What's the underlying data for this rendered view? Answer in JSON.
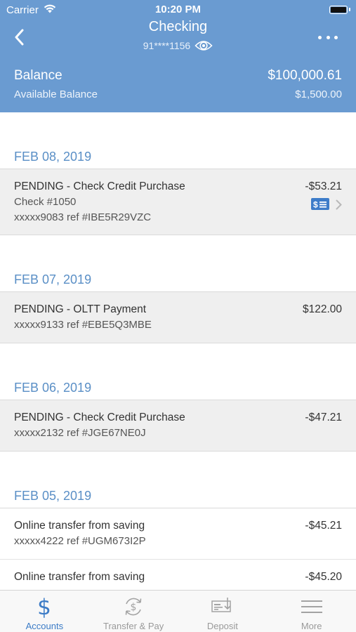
{
  "status_bar": {
    "carrier": "Carrier",
    "time": "10:20 PM"
  },
  "header": {
    "title": "Checking",
    "account_number": "91****1156",
    "balance_label": "Balance",
    "balance_value": "$100,000.61",
    "available_label": "Available Balance",
    "available_value": "$1,500.00"
  },
  "groups": [
    {
      "date": "FEB 08, 2019",
      "transactions": [
        {
          "description": "PENDING - Check Credit Purchase",
          "check": "Check #1050",
          "reference": "xxxxx9083 ref #IBE5R29VZC",
          "amount": "-$53.21"
        }
      ]
    },
    {
      "date": "FEB 07, 2019",
      "transactions": [
        {
          "description": "PENDING - OLTT Payment",
          "reference": "xxxxx9133 ref #EBE5Q3MBE",
          "amount": "$122.00"
        }
      ]
    },
    {
      "date": "FEB 06, 2019",
      "transactions": [
        {
          "description": "PENDING - Check Credit Purchase",
          "reference": "xxxxx2132 ref #JGE67NE0J",
          "amount": "-$47.21"
        }
      ]
    },
    {
      "date": "FEB 05, 2019",
      "transactions": [
        {
          "description": "Online transfer from saving",
          "reference": "xxxxx4222 ref #UGM673I2P",
          "amount": "-$45.21"
        },
        {
          "description": "Online transfer from saving",
          "amount": "-$45.20"
        }
      ]
    }
  ],
  "tabs": [
    {
      "label": "Accounts",
      "icon": "dollar-icon",
      "active": true
    },
    {
      "label": "Transfer & Pay",
      "icon": "transfer-icon"
    },
    {
      "label": "Deposit",
      "icon": "deposit-check-icon"
    },
    {
      "label": "More",
      "icon": "menu-icon"
    }
  ],
  "colors": {
    "header": "#6a9bd1",
    "accent": "#3b7bc6",
    "date": "#5a8fc6",
    "row_shade": "#efefef"
  }
}
